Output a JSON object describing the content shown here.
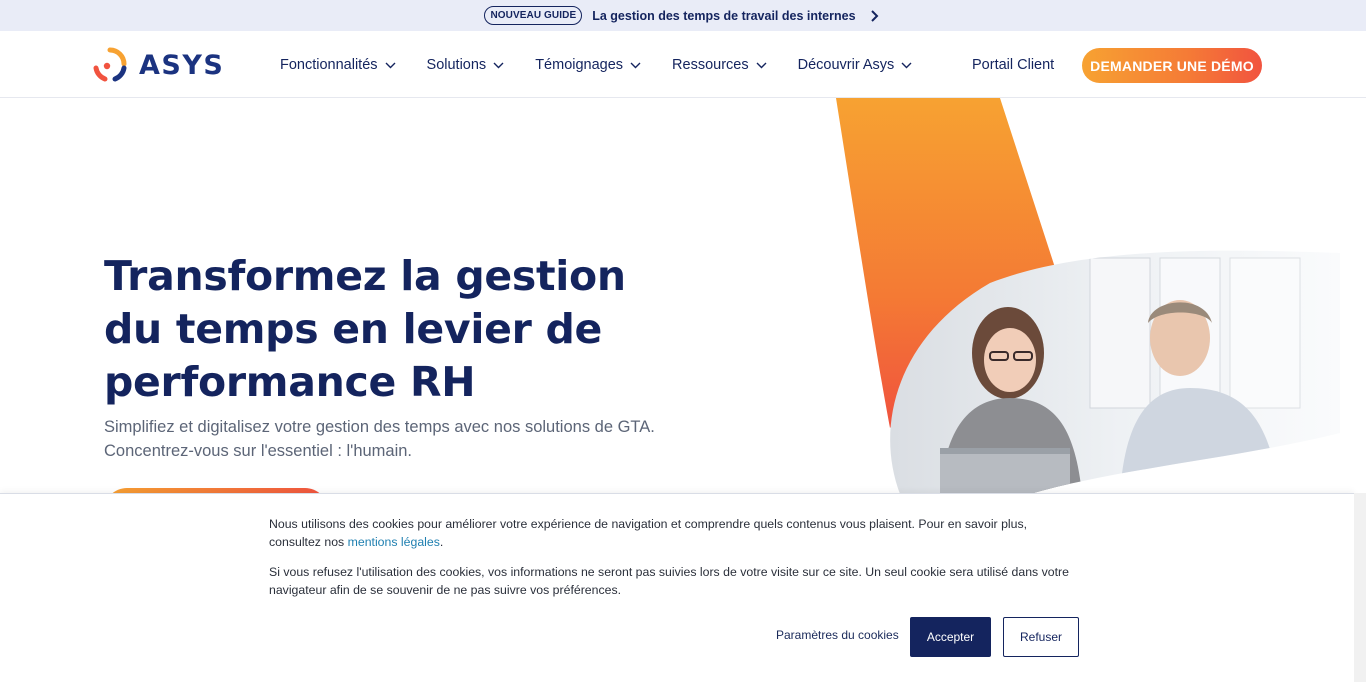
{
  "announcement": {
    "badge": "NOUVEAU GUIDE",
    "message": "La gestion des temps de travail des internes"
  },
  "header": {
    "logo_text": "ASYS",
    "nav": [
      {
        "label": "Fonctionnalités"
      },
      {
        "label": "Solutions"
      },
      {
        "label": "Témoignages"
      },
      {
        "label": "Ressources"
      },
      {
        "label": "Découvrir Asys"
      }
    ],
    "portal_label": "Portail Client",
    "demo_label": "DEMANDER UNE DÉMO"
  },
  "hero": {
    "title_line1": "Transformez la gestion",
    "title_line2": "du temps en levier de",
    "title_line3": "performance RH",
    "subtitle_line1": "Simplifiez et digitalisez votre gestion des temps avec nos solutions de GTA.",
    "subtitle_line2": "Concentrez-vous sur l'essentiel : l'humain."
  },
  "cookie": {
    "p1_before": "Nous utilisons des cookies pour améliorer votre expérience de navigation et comprendre quels contenus vous plaisent. Pour en savoir plus, consultez nos ",
    "p1_link": "mentions légales",
    "p1_after": ".",
    "p2": "Si vous refusez l'utilisation des cookies, vos informations ne seront pas suivies lors de votre visite sur ce site. Un seul cookie sera utilisé dans votre navigateur afin de se souvenir de ne pas suivre vos préférences.",
    "params_label": "Paramètres du cookies",
    "accept_label": "Accepter",
    "refuse_label": "Refuser"
  },
  "colors": {
    "navy": "#14245e",
    "orange": "#f7a232",
    "red_orange": "#f1533f",
    "link": "#1e7fb0"
  },
  "icons": [
    "chevron-right-icon",
    "chevron-down-icon",
    "asys-logo-icon"
  ]
}
